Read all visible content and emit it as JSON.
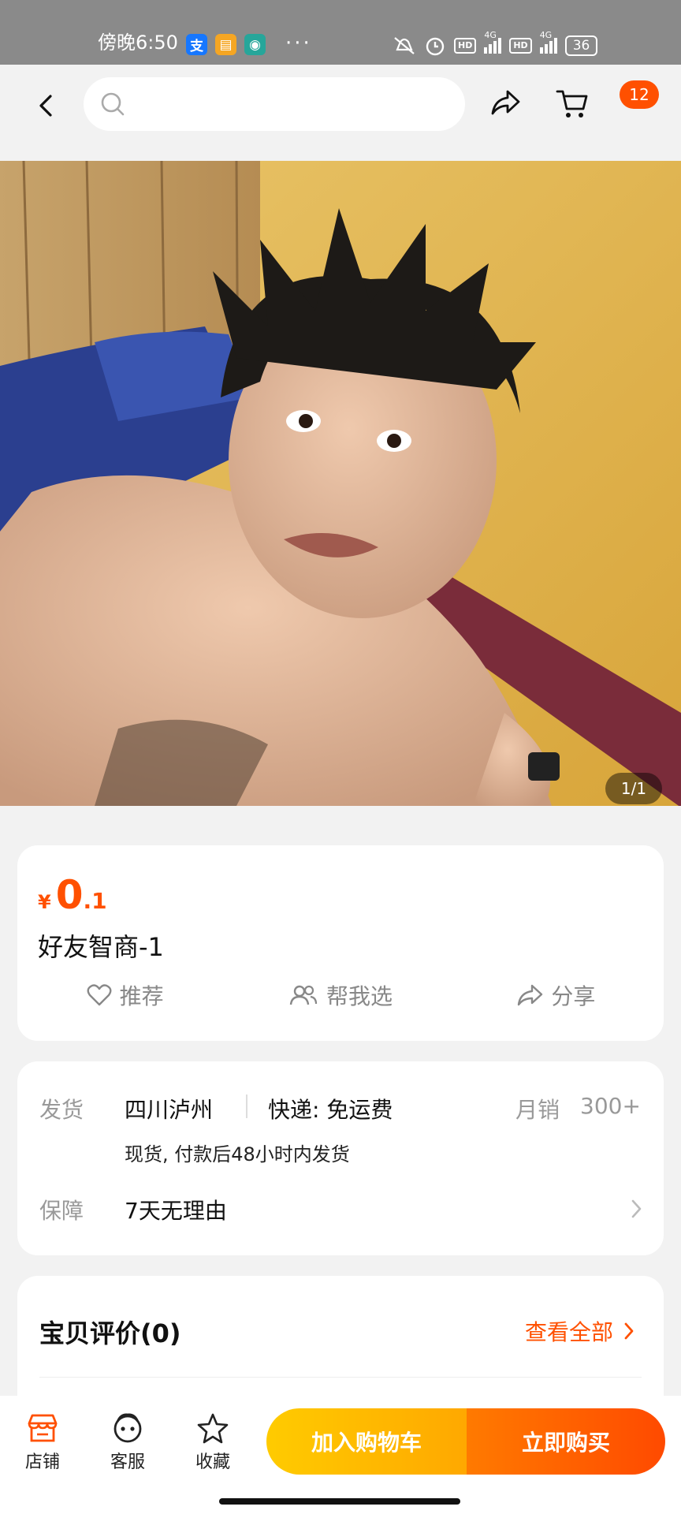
{
  "status_bar": {
    "time": "傍晚6:50",
    "app_icons": [
      "alipay-icon",
      "notes-icon",
      "app-icon"
    ],
    "dots": "···",
    "network1": "4G",
    "network2": "4G",
    "hd": "HD",
    "battery": "36"
  },
  "nav": {
    "search_placeholder": "",
    "cart_badge": "12"
  },
  "gallery": {
    "counter": "1/1"
  },
  "product": {
    "currency": "¥",
    "price_int": "0",
    "price_dec": ".1",
    "title": "好友智商-1",
    "actions": {
      "recommend": "推荐",
      "help_choose": "帮我选",
      "share": "分享"
    }
  },
  "shipping": {
    "label": "发货",
    "origin": "四川泸州",
    "express": "快递: 免运费",
    "sales_label": "月销",
    "sales_value": "300+",
    "note": "现货, 付款后48小时内发货",
    "guarantee_label": "保障",
    "guarantee_value": "7天无理由"
  },
  "reviews": {
    "title": "宝贝评价(0)",
    "view_all": "查看全部"
  },
  "bottom_bar": {
    "store": "店铺",
    "service": "客服",
    "favorite": "收藏",
    "add_to_cart": "加入购物车",
    "buy_now": "立即购买"
  },
  "colors": {
    "accent": "#ff5000",
    "cart_button": "#ffb300",
    "buy_button": "#ff5a00"
  }
}
